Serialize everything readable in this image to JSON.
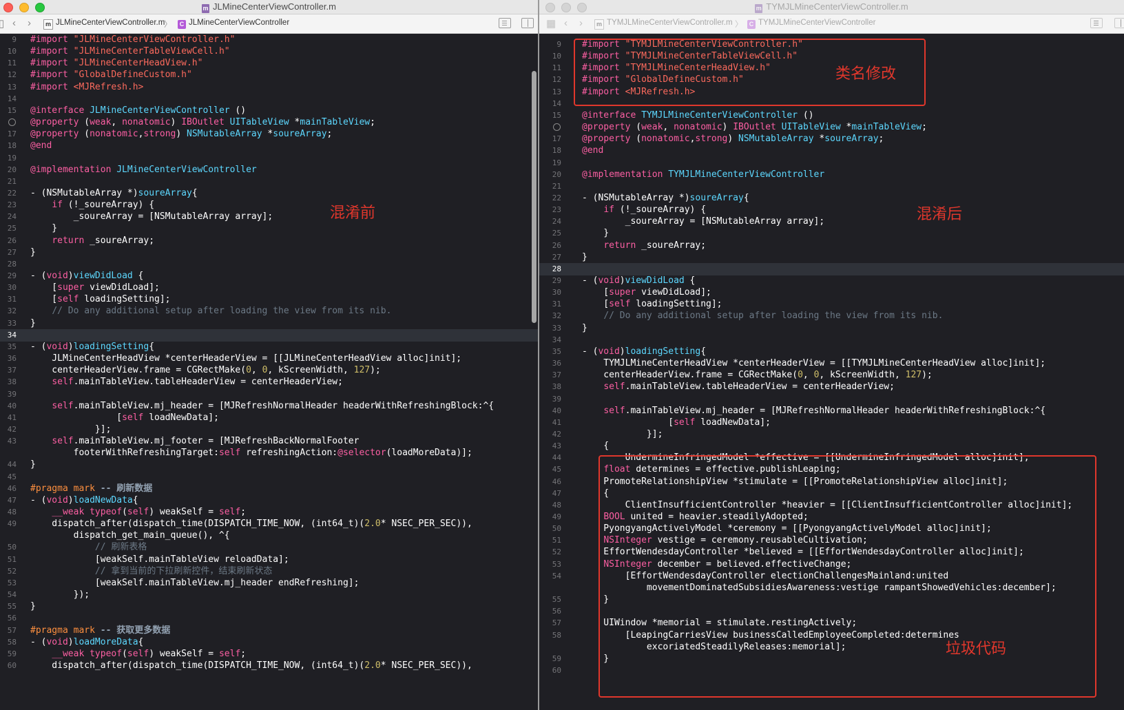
{
  "left": {
    "window_title": "JLMineCenterViewController.m",
    "jump_file": "JLMineCenterViewController.m",
    "jump_class": "JLMineCenterViewController",
    "annotation": "混淆前",
    "lines": [
      {
        "n": "9",
        "code": "<span class=\"k\">#import</span> <span class=\"s\">\"JLMineCenterViewController.h\"</span>"
      },
      {
        "n": "10",
        "code": "<span class=\"k\">#import</span> <span class=\"s\">\"JLMineCenterTableViewCell.h\"</span>"
      },
      {
        "n": "11",
        "code": "<span class=\"k\">#import</span> <span class=\"s\">\"JLMineCenterHeadView.h\"</span>"
      },
      {
        "n": "12",
        "code": "<span class=\"k\">#import</span> <span class=\"s\">\"GlobalDefineCustom.h\"</span>"
      },
      {
        "n": "13",
        "code": "<span class=\"k\">#import</span> <span class=\"s\">&lt;MJRefresh.h&gt;</span>"
      },
      {
        "n": "14",
        "code": ""
      },
      {
        "n": "15",
        "code": "<span class=\"k\">@interface</span> <span class=\"t\">JLMineCenterViewController</span> ()"
      },
      {
        "n": "",
        "bp": true,
        "code": "<span class=\"k\">@property</span> (<span class=\"k\">weak</span>, <span class=\"k\">nonatomic</span>) <span class=\"k\">IBOutlet</span> <span class=\"t\">UITableView</span> *<span class=\"t\">mainTableView</span>;"
      },
      {
        "n": "17",
        "code": "<span class=\"k\">@property</span> (<span class=\"k\">nonatomic</span>,<span class=\"k\">strong</span>) <span class=\"t\">NSMutableArray</span> *<span class=\"t\">soureArray</span>;"
      },
      {
        "n": "18",
        "code": "<span class=\"k\">@end</span>"
      },
      {
        "n": "19",
        "code": ""
      },
      {
        "n": "20",
        "code": "<span class=\"k\">@implementation</span> <span class=\"t\">JLMineCenterViewController</span>"
      },
      {
        "n": "21",
        "code": ""
      },
      {
        "n": "22",
        "code": "- (NSMutableArray *)<span class=\"t\">soureArray</span>{"
      },
      {
        "n": "23",
        "code": "    <span class=\"k\">if</span> (!_soureArray) {"
      },
      {
        "n": "24",
        "code": "        _soureArray = [NSMutableArray array];"
      },
      {
        "n": "25",
        "code": "    }"
      },
      {
        "n": "26",
        "code": "    <span class=\"k\">return</span> _soureArray;"
      },
      {
        "n": "27",
        "code": "}"
      },
      {
        "n": "28",
        "code": ""
      },
      {
        "n": "29",
        "code": "- (<span class=\"k\">void</span>)<span class=\"t\">viewDidLoad</span> {"
      },
      {
        "n": "30",
        "code": "    [<span class=\"k\">super</span> viewDidLoad];"
      },
      {
        "n": "31",
        "code": "    [<span class=\"k\">self</span> loadingSetting];"
      },
      {
        "n": "32",
        "code": "    <span class=\"c\">// Do any additional setup after loading the view from its nib.</span>"
      },
      {
        "n": "33",
        "code": "}"
      },
      {
        "n": "34",
        "cur": true,
        "code": ""
      },
      {
        "n": "35",
        "code": "- (<span class=\"k\">void</span>)<span class=\"t\">loadingSetting</span>{"
      },
      {
        "n": "36",
        "code": "    JLMineCenterHeadView *centerHeaderView = [[JLMineCenterHeadView alloc]init];"
      },
      {
        "n": "37",
        "code": "    centerHeaderView.frame = CGRectMake(<span class=\"n\">0</span>, <span class=\"n\">0</span>, kScreenWidth, <span class=\"n\">127</span>);"
      },
      {
        "n": "38",
        "code": "    <span class=\"k\">self</span>.mainTableView.tableHeaderView = centerHeaderView;"
      },
      {
        "n": "39",
        "code": ""
      },
      {
        "n": "40",
        "code": "    <span class=\"k\">self</span>.mainTableView.mj_header = [MJRefreshNormalHeader headerWithRefreshingBlock:^{"
      },
      {
        "n": "41",
        "code": "                [<span class=\"k\">self</span> loadNewData];"
      },
      {
        "n": "42",
        "code": "            }];"
      },
      {
        "n": "43",
        "code": "    <span class=\"k\">self</span>.mainTableView.mj_footer = [MJRefreshBackNormalFooter"
      },
      {
        "n": "",
        "code": "        footerWithRefreshingTarget:<span class=\"k\">self</span> refreshingAction:<span class=\"k\">@selector</span>(loadMoreData)];"
      },
      {
        "n": "44",
        "code": "}"
      },
      {
        "n": "45",
        "code": ""
      },
      {
        "n": "46",
        "code": "<span class=\"p\">#pragma mark</span> <span class=\"pm\">-- 刷新数据</span>"
      },
      {
        "n": "47",
        "code": "- (<span class=\"k\">void</span>)<span class=\"t\">loadNewData</span>{"
      },
      {
        "n": "48",
        "code": "    <span class=\"k\">__weak</span> <span class=\"k\">typeof</span>(<span class=\"k\">self</span>) weakSelf = <span class=\"k\">self</span>;"
      },
      {
        "n": "49",
        "code": "    dispatch_after(dispatch_time(DISPATCH_TIME_NOW, (int64_t)(<span class=\"n\">2.0</span>* NSEC_PER_SEC)),"
      },
      {
        "n": "",
        "code": "        dispatch_get_main_queue(), ^{"
      },
      {
        "n": "50",
        "code": "            <span class=\"c\">// 刷新表格</span>"
      },
      {
        "n": "51",
        "code": "            [weakSelf.mainTableView reloadData];"
      },
      {
        "n": "52",
        "code": "            <span class=\"c\">// 拿到当前的下拉刷新控件，结束刷新状态</span>"
      },
      {
        "n": "53",
        "code": "            [weakSelf.mainTableView.mj_header endRefreshing];"
      },
      {
        "n": "54",
        "code": "        });"
      },
      {
        "n": "55",
        "code": "}"
      },
      {
        "n": "56",
        "code": ""
      },
      {
        "n": "57",
        "code": "<span class=\"p\">#pragma mark</span> <span class=\"pm\">-- 获取更多数据</span>"
      },
      {
        "n": "58",
        "code": "- (<span class=\"k\">void</span>)<span class=\"t\">loadMoreData</span>{"
      },
      {
        "n": "59",
        "code": "    <span class=\"k\">__weak</span> <span class=\"k\">typeof</span>(<span class=\"k\">self</span>) weakSelf = <span class=\"k\">self</span>;"
      },
      {
        "n": "60",
        "code": "    dispatch_after(dispatch_time(DISPATCH_TIME_NOW, (int64_t)(<span class=\"n\">2.0</span>* NSEC_PER_SEC)),"
      }
    ]
  },
  "right": {
    "window_title": "TYMJLMineCenterViewController.m",
    "jump_file": "TYMJLMineCenterViewController.m",
    "jump_class": "TYMJLMineCenterViewController",
    "annotations": {
      "rename": "类名修改",
      "after": "混淆后",
      "junk": "垃圾代码"
    },
    "lines": [
      {
        "n": "9",
        "code": "<span class=\"k\">#import</span> <span class=\"s\">\"TYMJLMineCenterViewController.h\"</span>"
      },
      {
        "n": "10",
        "code": "<span class=\"k\">#import</span> <span class=\"s\">\"TYMJLMineCenterTableViewCell.h\"</span>"
      },
      {
        "n": "11",
        "code": "<span class=\"k\">#import</span> <span class=\"s\">\"TYMJLMineCenterHeadView.h\"</span>"
      },
      {
        "n": "12",
        "code": "<span class=\"k\">#import</span> <span class=\"s\">\"GlobalDefineCustom.h\"</span>"
      },
      {
        "n": "13",
        "code": "<span class=\"k\">#import</span> <span class=\"s\">&lt;MJRefresh.h&gt;</span>"
      },
      {
        "n": "14",
        "code": ""
      },
      {
        "n": "15",
        "code": "<span class=\"k\">@interface</span> <span class=\"t\">TYMJLMineCenterViewController</span> ()"
      },
      {
        "n": "",
        "bp": true,
        "code": "<span class=\"k\">@property</span> (<span class=\"k\">weak</span>, <span class=\"k\">nonatomic</span>) <span class=\"k\">IBOutlet</span> <span class=\"t\">UITableView</span> *<span class=\"t\">mainTableView</span>;"
      },
      {
        "n": "17",
        "code": "<span class=\"k\">@property</span> (<span class=\"k\">nonatomic</span>,<span class=\"k\">strong</span>) <span class=\"t\">NSMutableArray</span> *<span class=\"t\">soureArray</span>;"
      },
      {
        "n": "18",
        "code": "<span class=\"k\">@end</span>"
      },
      {
        "n": "19",
        "code": ""
      },
      {
        "n": "20",
        "code": "<span class=\"k\">@implementation</span> <span class=\"t\">TYMJLMineCenterViewController</span>"
      },
      {
        "n": "21",
        "code": ""
      },
      {
        "n": "22",
        "code": "- (NSMutableArray *)<span class=\"t\">soureArray</span>{"
      },
      {
        "n": "23",
        "code": "    <span class=\"k\">if</span> (!_soureArray) {"
      },
      {
        "n": "24",
        "code": "        _soureArray = [NSMutableArray array];"
      },
      {
        "n": "25",
        "code": "    }"
      },
      {
        "n": "26",
        "code": "    <span class=\"k\">return</span> _soureArray;"
      },
      {
        "n": "27",
        "code": "}"
      },
      {
        "n": "28",
        "cur": true,
        "code": ""
      },
      {
        "n": "29",
        "code": "- (<span class=\"k\">void</span>)<span class=\"t\">viewDidLoad</span> {"
      },
      {
        "n": "30",
        "code": "    [<span class=\"k\">super</span> viewDidLoad];"
      },
      {
        "n": "31",
        "code": "    [<span class=\"k\">self</span> loadingSetting];"
      },
      {
        "n": "32",
        "code": "    <span class=\"c\">// Do any additional setup after loading the view from its nib.</span>"
      },
      {
        "n": "33",
        "code": "}"
      },
      {
        "n": "34",
        "code": ""
      },
      {
        "n": "35",
        "code": "- (<span class=\"k\">void</span>)<span class=\"t\">loadingSetting</span>{"
      },
      {
        "n": "36",
        "code": "    TYMJLMineCenterHeadView *centerHeaderView = [[TYMJLMineCenterHeadView alloc]init];"
      },
      {
        "n": "37",
        "code": "    centerHeaderView.frame = CGRectMake(<span class=\"n\">0</span>, <span class=\"n\">0</span>, kScreenWidth, <span class=\"n\">127</span>);"
      },
      {
        "n": "38",
        "code": "    <span class=\"k\">self</span>.mainTableView.tableHeaderView = centerHeaderView;"
      },
      {
        "n": "39",
        "code": ""
      },
      {
        "n": "40",
        "code": "    <span class=\"k\">self</span>.mainTableView.mj_header = [MJRefreshNormalHeader headerWithRefreshingBlock:^{"
      },
      {
        "n": "41",
        "code": "                [<span class=\"k\">self</span> loadNewData];"
      },
      {
        "n": "42",
        "code": "            }];"
      },
      {
        "n": "43",
        "code": "    {"
      },
      {
        "n": "44",
        "code": "        UndermineInfringedModel *effective = [[UndermineInfringedModel alloc]init];"
      },
      {
        "n": "45",
        "code": "    <span class=\"k\">float</span> determines = effective.publishLeaping;"
      },
      {
        "n": "46",
        "code": "    PromoteRelationshipView *stimulate = [[PromoteRelationshipView alloc]init];"
      },
      {
        "n": "47",
        "code": "    {"
      },
      {
        "n": "48",
        "code": "        ClientInsufficientController *heavier = [[ClientInsufficientController alloc]init];"
      },
      {
        "n": "49",
        "code": "    <span class=\"k\">BOOL</span> united = heavier.steadilyAdopted;"
      },
      {
        "n": "50",
        "code": "    PyongyangActivelyModel *ceremony = [[PyongyangActivelyModel alloc]init];"
      },
      {
        "n": "51",
        "code": "    <span class=\"k\">NSInteger</span> vestige = ceremony.reusableCultivation;"
      },
      {
        "n": "52",
        "code": "    EffortWendesdayController *believed = [[EffortWendesdayController alloc]init];"
      },
      {
        "n": "53",
        "code": "    <span class=\"k\">NSInteger</span> december = believed.effectiveChange;"
      },
      {
        "n": "54",
        "code": "        [EffortWendesdayController electionChallengesMainland:united"
      },
      {
        "n": "",
        "code": "            movementDominatedSubsidiesAwareness:vestige rampantShowedVehicles:december];"
      },
      {
        "n": "55",
        "code": "    }"
      },
      {
        "n": "56",
        "code": ""
      },
      {
        "n": "57",
        "code": "    UIWindow *memorial = stimulate.restingActively;"
      },
      {
        "n": "58",
        "code": "        [LeapingCarriesView businessCalledEmployeeCompleted:determines"
      },
      {
        "n": "",
        "code": "            excoriatedSteadilyReleases:memorial];"
      },
      {
        "n": "59",
        "code": "    }"
      },
      {
        "n": "60",
        "code": ""
      }
    ]
  }
}
